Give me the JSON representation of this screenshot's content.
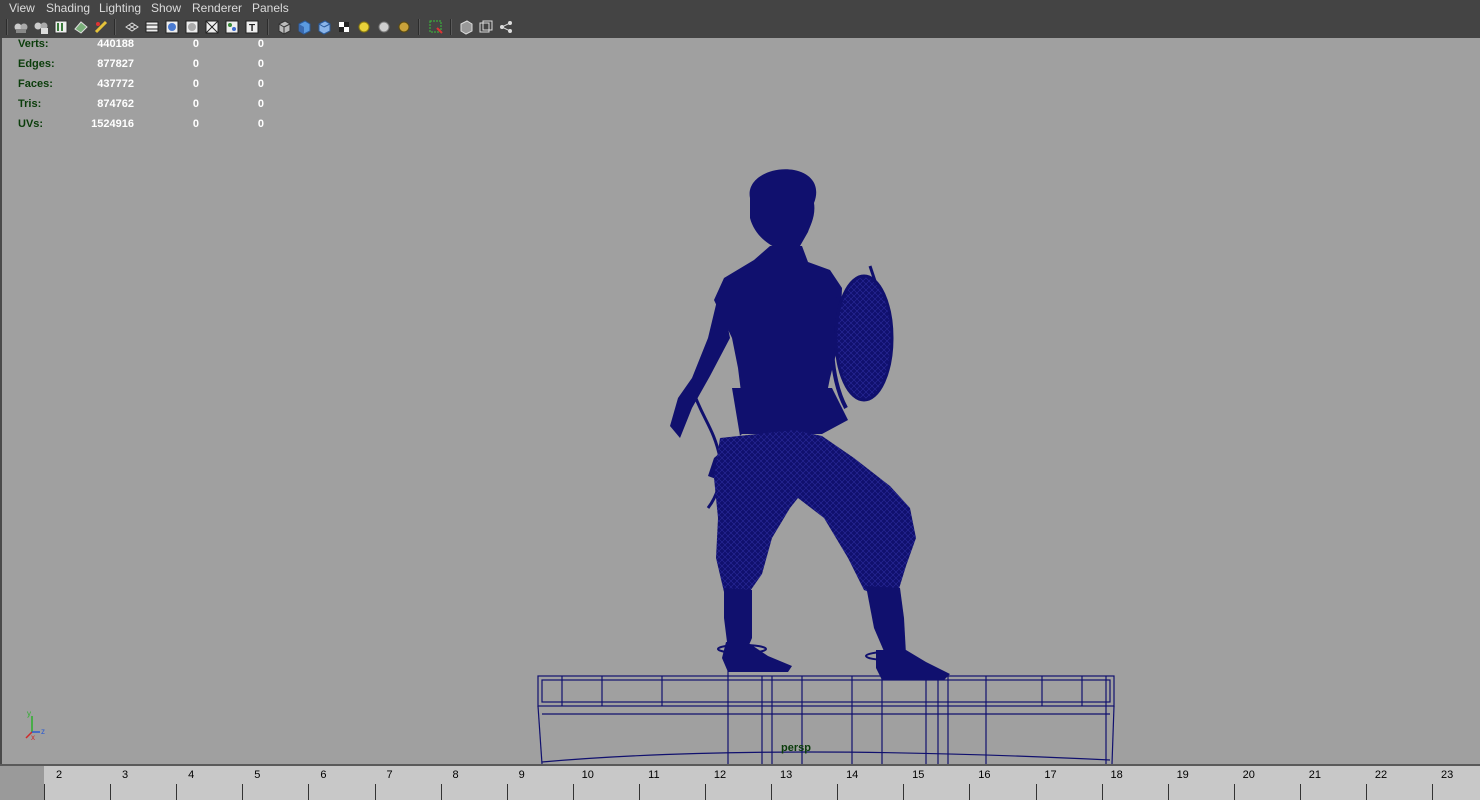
{
  "menu": [
    "View",
    "Shading",
    "Lighting",
    "Show",
    "Renderer",
    "Panels"
  ],
  "toolbar": {
    "icons": [
      "camera-select-icon",
      "camera-lock-icon",
      "bookmark-icon",
      "image-plane-icon",
      "grease-pencil-icon",
      "wireframe-grid-icon",
      "film-gate-icon",
      "resolution-gate-icon",
      "field-chart-icon",
      "safe-action-icon",
      "safe-title-icon",
      "text-icon",
      "wireframe-icon",
      "smooth-shade-icon",
      "flat-shade-icon",
      "checker-texture-icon",
      "default-light-icon",
      "all-lights-icon",
      "shadows-icon",
      "isolate-select-icon",
      "xray-icon",
      "xray-joints-icon",
      "share-icon"
    ]
  },
  "hud": {
    "rows": [
      {
        "label": "Verts:",
        "v1": "440188",
        "v2": "0",
        "v3": "0"
      },
      {
        "label": "Edges:",
        "v1": "877827",
        "v2": "0",
        "v3": "0"
      },
      {
        "label": "Faces:",
        "v1": "437772",
        "v2": "0",
        "v3": "0"
      },
      {
        "label": "Tris:",
        "v1": "874762",
        "v2": "0",
        "v3": "0"
      },
      {
        "label": "UVs:",
        "v1": "1524916",
        "v2": "0",
        "v3": "0"
      }
    ]
  },
  "viewport": {
    "camera": "persp",
    "background_color": "#a0a0a0",
    "wireframe_color": "#10106e",
    "axis": {
      "y": "y",
      "x": "x",
      "z": "z"
    }
  },
  "timeline": {
    "frames": [
      "2",
      "3",
      "4",
      "5",
      "6",
      "7",
      "8",
      "9",
      "10",
      "11",
      "12",
      "13",
      "14",
      "15",
      "16",
      "17",
      "18",
      "19",
      "20",
      "21",
      "22",
      "23"
    ]
  }
}
